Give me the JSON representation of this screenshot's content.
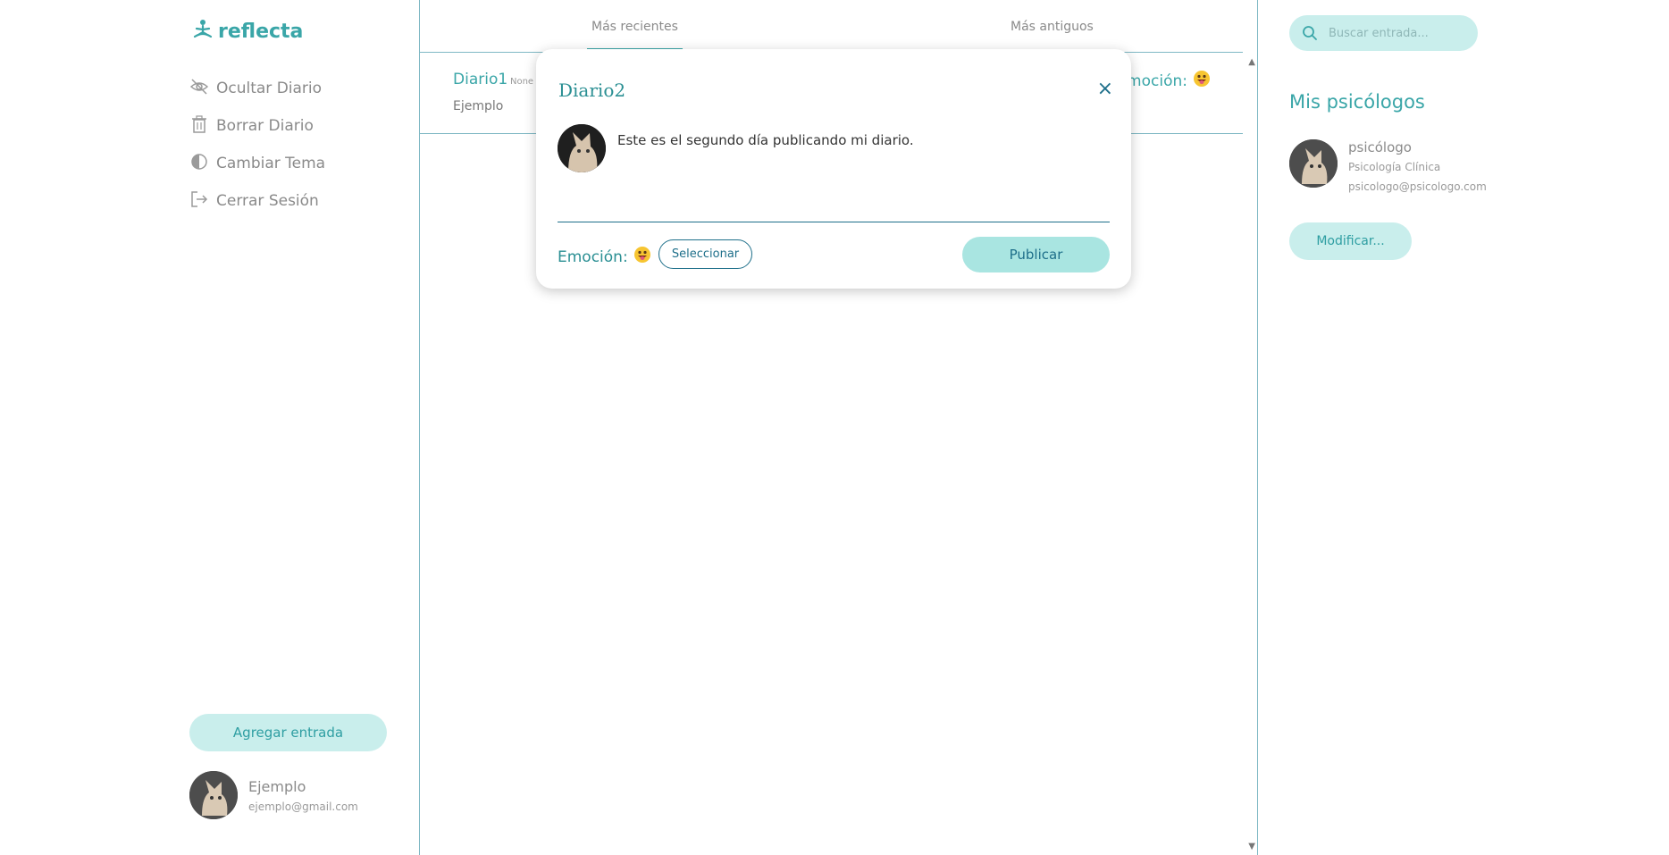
{
  "app": {
    "name": "reflecta",
    "brand_color": "#3aa6a8",
    "logo_icon": "meditation-icon"
  },
  "sidebar": {
    "items": [
      {
        "label": "Ocultar Diario",
        "icon": "eye-slash-icon"
      },
      {
        "label": "Borrar Diario",
        "icon": "trash-icon"
      },
      {
        "label": "Cambiar Tema",
        "icon": "half-circle-icon"
      },
      {
        "label": "Cerrar Sesión",
        "icon": "logout-icon"
      }
    ],
    "add_button": "Agregar entrada",
    "user": {
      "name": "Ejemplo",
      "email": "ejemplo@gmail.com"
    }
  },
  "feed": {
    "tabs": [
      {
        "label": "Más recientes",
        "active": true
      },
      {
        "label": "Más antiguos",
        "active": false
      }
    ],
    "entry": {
      "title": "Diario1",
      "tag": "None",
      "body": "Ejemplo",
      "emotion_label": "Emoción:",
      "emotion_icon": "tongue-out-emoji"
    }
  },
  "right": {
    "search_placeholder": "Buscar entrada...",
    "heading": "Mis psicólogos",
    "psychologist": {
      "name": "psicólogo",
      "specialty": "Psicología Clínica",
      "email": "psicologo@psicologo.com"
    },
    "modify_button": "Modificar..."
  },
  "modal": {
    "title": "Diario2",
    "close": "×",
    "text": "Este es el segundo día publicando mi diario.",
    "emotion_label": "Emoción:",
    "emotion_icon": "tongue-out-emoji",
    "select_button": "Seleccionar",
    "publish_button": "Publicar"
  }
}
